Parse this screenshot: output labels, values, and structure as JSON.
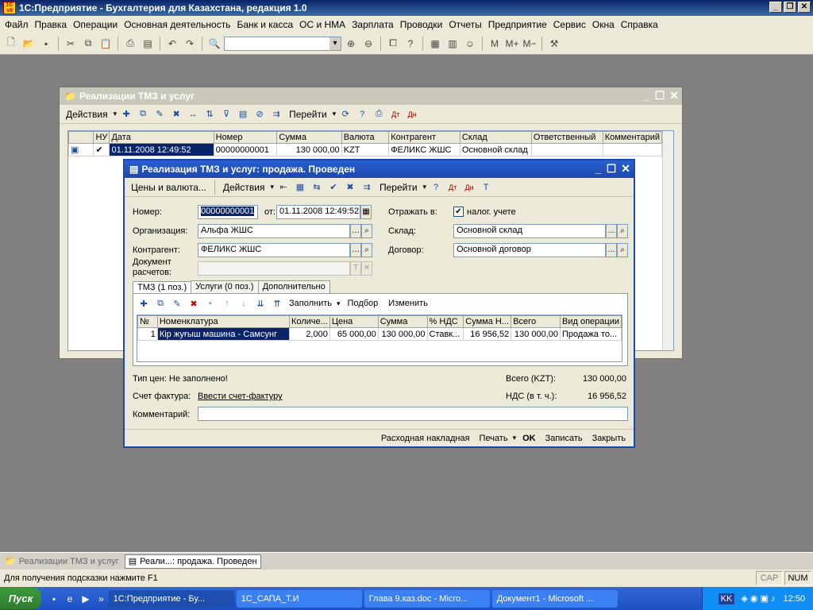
{
  "app": {
    "title": "1С:Предприятие - Бухгалтерия для Казахстана, редакция 1.0",
    "logo": "1С v8"
  },
  "menu": [
    "Файл",
    "Правка",
    "Операции",
    "Основная деятельность",
    "Банк и касса",
    "ОС и НМА",
    "Зарплата",
    "Проводки",
    "Отчеты",
    "Предприятие",
    "Сервис",
    "Окна",
    "Справка"
  ],
  "list_window": {
    "title": "Реализации ТМЗ и услуг",
    "actions": "Действия",
    "goto": "Перейти",
    "columns": [
      "НУ",
      "Дата",
      "Номер",
      "Сумма",
      "Валюта",
      "Контрагент",
      "Склад",
      "Ответственный",
      "Комментарий"
    ],
    "row": {
      "nu": "✔",
      "date": "01.11.2008 12:49:52",
      "number": "00000000001",
      "sum": "130 000,00",
      "currency": "KZT",
      "contractor": "ФЕЛИКС ЖШС",
      "warehouse": "Основной склад",
      "resp": "",
      "comment": ""
    }
  },
  "doc_window": {
    "title": "Реализация ТМЗ и услуг: продажа. Проведен",
    "prices_btn": "Цены и валюта...",
    "actions": "Действия",
    "goto": "Перейти",
    "number_label": "Номер:",
    "number": "00000000001",
    "from_label": "от:",
    "date": "01.11.2008 12:49:52",
    "reflect_label": "Отражать в:",
    "tax_label": "налог. учете",
    "org_label": "Организация:",
    "org": "Альфа ЖШС",
    "wh_label": "Склад:",
    "wh": "Основной склад",
    "contr_label": "Контрагент:",
    "contr": "ФЕЛИКС ЖШС",
    "contract_label": "Договор:",
    "contract": "Основной договор",
    "settle_label1": "Документ",
    "settle_label2": "расчетов:",
    "tabs": [
      "ТМЗ (1 поз.)",
      "Услуги (0 поз.)",
      "Дополнительно"
    ],
    "fill": "Заполнить",
    "pick": "Подбор",
    "change": "Изменить",
    "columns": [
      "№",
      "Номенклатура",
      "Количе...",
      "Цена",
      "Сумма",
      "% НДС",
      "Сумма Н...",
      "Всего",
      "Вид операции"
    ],
    "row": {
      "n": "1",
      "item": "Кір жуғыш машина - Самсунг",
      "qty": "2,000",
      "price": "65 000,00",
      "sum": "130 000,00",
      "vat": "Ставк...",
      "vatsum": "16 956,52",
      "total": "130 000,00",
      "op": "Продажа то..."
    },
    "price_type": "Тип цен: Не заполнено!",
    "total_label": "Всего (KZT):",
    "total": "130 000,00",
    "invoice_label": "Счет фактура:",
    "invoice_link": "Ввести счет-фактуру",
    "vat_label": "НДС (в т. ч.):",
    "vat": "16 956,52",
    "comment_label": "Комментарий:",
    "comment": "",
    "footer": {
      "waybill": "Расходная накладная",
      "print": "Печать",
      "ok": "OK",
      "save": "Записать",
      "close": "Закрыть"
    }
  },
  "open_docs": [
    "Реализации ТМЗ и услуг",
    "Реали...: продажа. Проведен"
  ],
  "status": {
    "hint": "Для получения подсказки нажмите F1",
    "cap": "CAP",
    "num": "NUM"
  },
  "taskbar": {
    "start": "Пуск",
    "tasks": [
      "1С:Предприятие - Бу...",
      "1С_САПА_Т.И",
      "Глава 9.каз.doc - Micro...",
      "Документ1 - Microsoft ..."
    ],
    "lang": "KK",
    "time": "12:50"
  }
}
